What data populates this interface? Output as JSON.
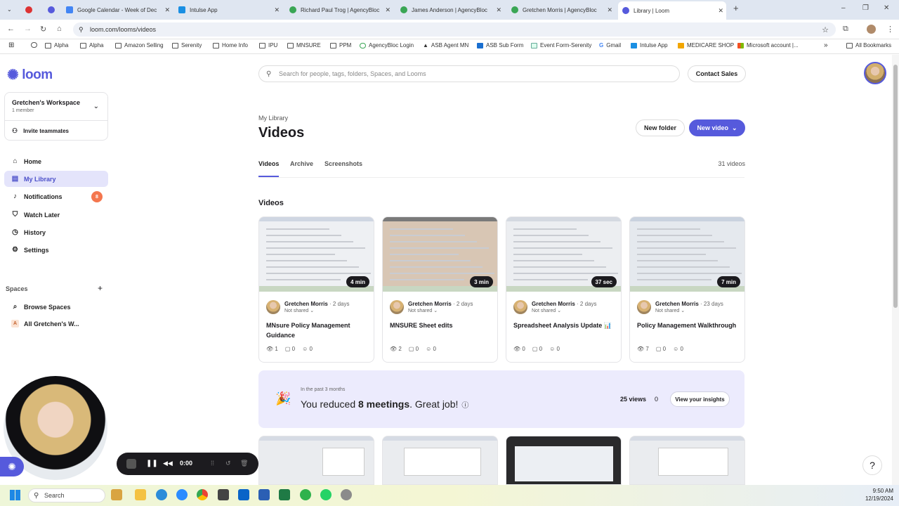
{
  "browser": {
    "tabs": [
      {
        "title": "",
        "color": "#444"
      },
      {
        "title": "",
        "color": "#d33"
      },
      {
        "title": "",
        "color": "#565adc"
      },
      {
        "title": "Google Calendar - Week of Dec",
        "color": "#4285f4"
      },
      {
        "title": "Intulse App",
        "color": "#1a8fe3"
      },
      {
        "title": "Richard Paul Trog | AgencyBloc",
        "color": "#3aa655"
      },
      {
        "title": "James Anderson | AgencyBloc",
        "color": "#3aa655"
      },
      {
        "title": "Gretchen Morris | AgencyBloc",
        "color": "#3aa655"
      },
      {
        "title": "Library | Loom",
        "color": "#565adc"
      }
    ],
    "url": "loom.com/looms/videos",
    "bookmarks": [
      "Alpha",
      "Alpha",
      "Amazon Selling",
      "Serenity",
      "Home Info",
      "IPU",
      "MNSURE",
      "PPM",
      "AgencyBloc Login",
      "ASB Agent MN",
      "ASB Sub Form",
      "Event Form-Serenity",
      "Gmail",
      "Intulse App",
      "MEDICARE SHOP",
      "Microsoft account |..."
    ],
    "all_bookmarks": "All Bookmarks"
  },
  "sidebar": {
    "logo": "loom",
    "workspace_name": "Gretchen's Workspace",
    "workspace_members": "1 member",
    "invite": "Invite teammates",
    "nav": [
      {
        "label": "Home",
        "icon": "home-icon",
        "glyph": "⌂"
      },
      {
        "label": "My Library",
        "icon": "library-icon",
        "glyph": "▤"
      },
      {
        "label": "Notifications",
        "icon": "bell-icon",
        "glyph": "♪"
      },
      {
        "label": "Watch Later",
        "icon": "bookmark-icon",
        "glyph": "⛉"
      },
      {
        "label": "History",
        "icon": "history-icon",
        "glyph": "◷"
      },
      {
        "label": "Settings",
        "icon": "gear-icon",
        "glyph": "⚙"
      }
    ],
    "notification_count": "8",
    "spaces_title": "Spaces",
    "spaces": [
      {
        "label": "Browse Spaces",
        "glyph": "⌕"
      },
      {
        "label": "All Gretchen's W...",
        "glyph": "A"
      }
    ]
  },
  "header": {
    "search_placeholder": "Search for people, tags, folders, Spaces, and Looms",
    "contact_sales": "Contact Sales",
    "crumb": "My Library",
    "title": "Videos",
    "new_folder": "New folder",
    "new_video": "New video",
    "tabs": [
      "Videos",
      "Archive",
      "Screenshots"
    ],
    "video_count": "31 videos"
  },
  "section_title": "Videos",
  "videos": [
    {
      "title": "MNsure Policy Management Guidance",
      "author": "Gretchen Morris",
      "age": "2 days",
      "shared": "Not shared",
      "duration": "4 min",
      "views": "1",
      "comments": "0",
      "reactions": "0"
    },
    {
      "title": "MNSURE Sheet edits",
      "author": "Gretchen Morris",
      "age": "2 days",
      "shared": "Not shared",
      "duration": "3 min",
      "views": "2",
      "comments": "0",
      "reactions": "0"
    },
    {
      "title": "Spreadsheet Analysis Update 📊",
      "author": "Gretchen Morris",
      "age": "2 days",
      "shared": "Not shared",
      "duration": "37 sec",
      "views": "0",
      "comments": "0",
      "reactions": "0"
    },
    {
      "title": "Policy Management Walkthrough",
      "author": "Gretchen Morris",
      "age": "23 days",
      "shared": "Not shared",
      "duration": "7 min",
      "views": "7",
      "comments": "0",
      "reactions": "0"
    }
  ],
  "insight": {
    "period": "In the past 3 months",
    "message_pre": "You reduced ",
    "message_bold": "8 meetings",
    "message_post": ". Great job!",
    "views": "25 views",
    "zero": "0",
    "button": "View your insights"
  },
  "recorder": {
    "time": "0:00"
  },
  "help": "?",
  "taskbar": {
    "search": "Search",
    "time": "9:50 AM",
    "date": "12/19/2024"
  }
}
